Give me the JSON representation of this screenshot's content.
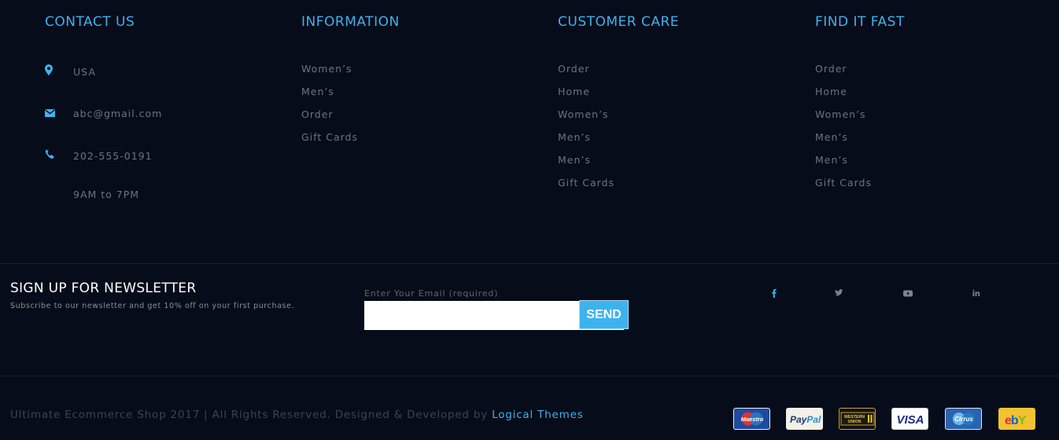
{
  "contact": {
    "title": "CONTACT US",
    "location": "USA",
    "email": "abc@gmail.com",
    "phone": "202-555-0191",
    "hours": "9AM to 7PM"
  },
  "information": {
    "title": "INFORMATION",
    "items": [
      "Women’s",
      "Men’s",
      "Order",
      "Gift Cards"
    ]
  },
  "customer_care": {
    "title": "CUSTOMER CARE",
    "items": [
      "Order",
      "Home",
      "Women’s",
      "Men’s",
      "Men’s",
      "Gift Cards"
    ]
  },
  "find_it_fast": {
    "title": "FIND IT FAST",
    "items": [
      "Order",
      "Home",
      "Women’s",
      "Men’s",
      "Men’s",
      "Gift Cards"
    ]
  },
  "newsletter": {
    "title": "SIGN UP FOR NEWSLETTER",
    "subtitle": "Subscribe to our newsletter and get 10% off on your first purchase.",
    "email_label": "Enter Your Email (required)",
    "email_value": "",
    "send_label": "SEND"
  },
  "social": [
    "facebook-icon",
    "twitter-icon",
    "youtube-icon",
    "linkedin-icon"
  ],
  "footer": {
    "copyright": "Ultimate Ecommerce Shop 2017 | All Rights Reserved. Designed & Developed by ",
    "link": "Logical Themes"
  },
  "payments": {
    "maestro": "Maestro",
    "paypal_pay": "Pay",
    "paypal_pal": "Pal",
    "western_union_line1": "WESTERN",
    "western_union_line2": "UNION",
    "visa": "VISA",
    "cirrus": "Cirrus",
    "ebay_e": "e",
    "ebay_b": "b",
    "ebay_y": "Y"
  },
  "colors": {
    "background": "#060c19",
    "accent": "#3fb1ef",
    "send_button": "#3db3ee"
  }
}
